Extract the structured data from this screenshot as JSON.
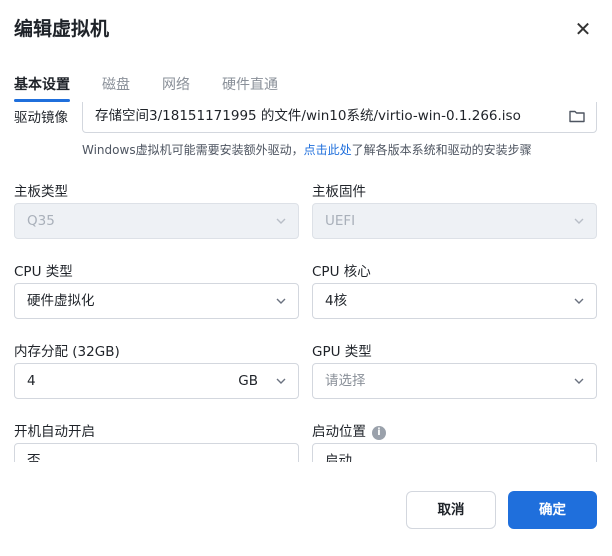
{
  "dialog": {
    "title": "编辑虚拟机",
    "close_symbol": "✕"
  },
  "tabs": [
    {
      "label": "基本设置",
      "active": true
    },
    {
      "label": "磁盘",
      "active": false
    },
    {
      "label": "网络",
      "active": false
    },
    {
      "label": "硬件直通",
      "active": false
    }
  ],
  "driver": {
    "label": "驱动镜像",
    "value": "存储空间3/18151171995 的文件/win10系统/virtio-win-0.1.266.iso",
    "hint_prefix": "Windows虚拟机可能需要安装额外驱动，",
    "hint_link": "点击此处",
    "hint_suffix": "了解各版本系统和驱动的安装步骤"
  },
  "board_type": {
    "label": "主板类型",
    "value": "Q35",
    "disabled": true
  },
  "board_firmware": {
    "label": "主板固件",
    "value": "UEFI",
    "disabled": true
  },
  "cpu_type": {
    "label": "CPU 类型",
    "value": "硬件虚拟化"
  },
  "cpu_cores": {
    "label": "CPU 核心",
    "value": "4核"
  },
  "memory": {
    "label": "内存分配 (32GB)",
    "value": "4",
    "unit": "GB"
  },
  "gpu_type": {
    "label": "GPU 类型",
    "placeholder": "请选择"
  },
  "autostart": {
    "label": "开机自动开启",
    "value": "否"
  },
  "boot_position": {
    "label": "启动位置",
    "value": "启动",
    "info_symbol": "i"
  },
  "footer": {
    "cancel_label": "取消",
    "ok_label": "确定"
  },
  "colors": {
    "accent": "#1f6fdc",
    "disabled_bg": "#eef1f5"
  }
}
